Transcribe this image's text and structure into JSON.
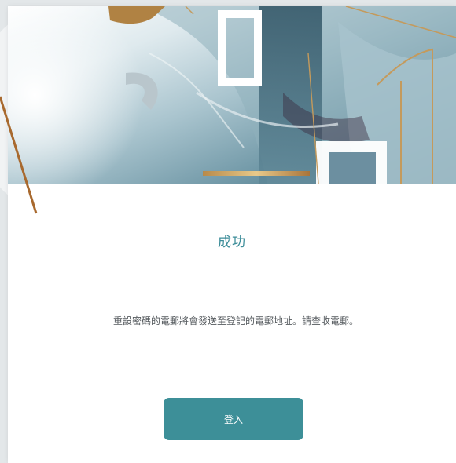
{
  "dialog": {
    "title": "成功",
    "message": "重設密碼的電郵將會發送至登記的電郵地址。請查收電郵。",
    "login_button_label": "登入"
  },
  "colors": {
    "accent": "#3d8f98",
    "title": "#3d8d99",
    "body_text": "#555a5e",
    "gold": "#b07a3a"
  }
}
